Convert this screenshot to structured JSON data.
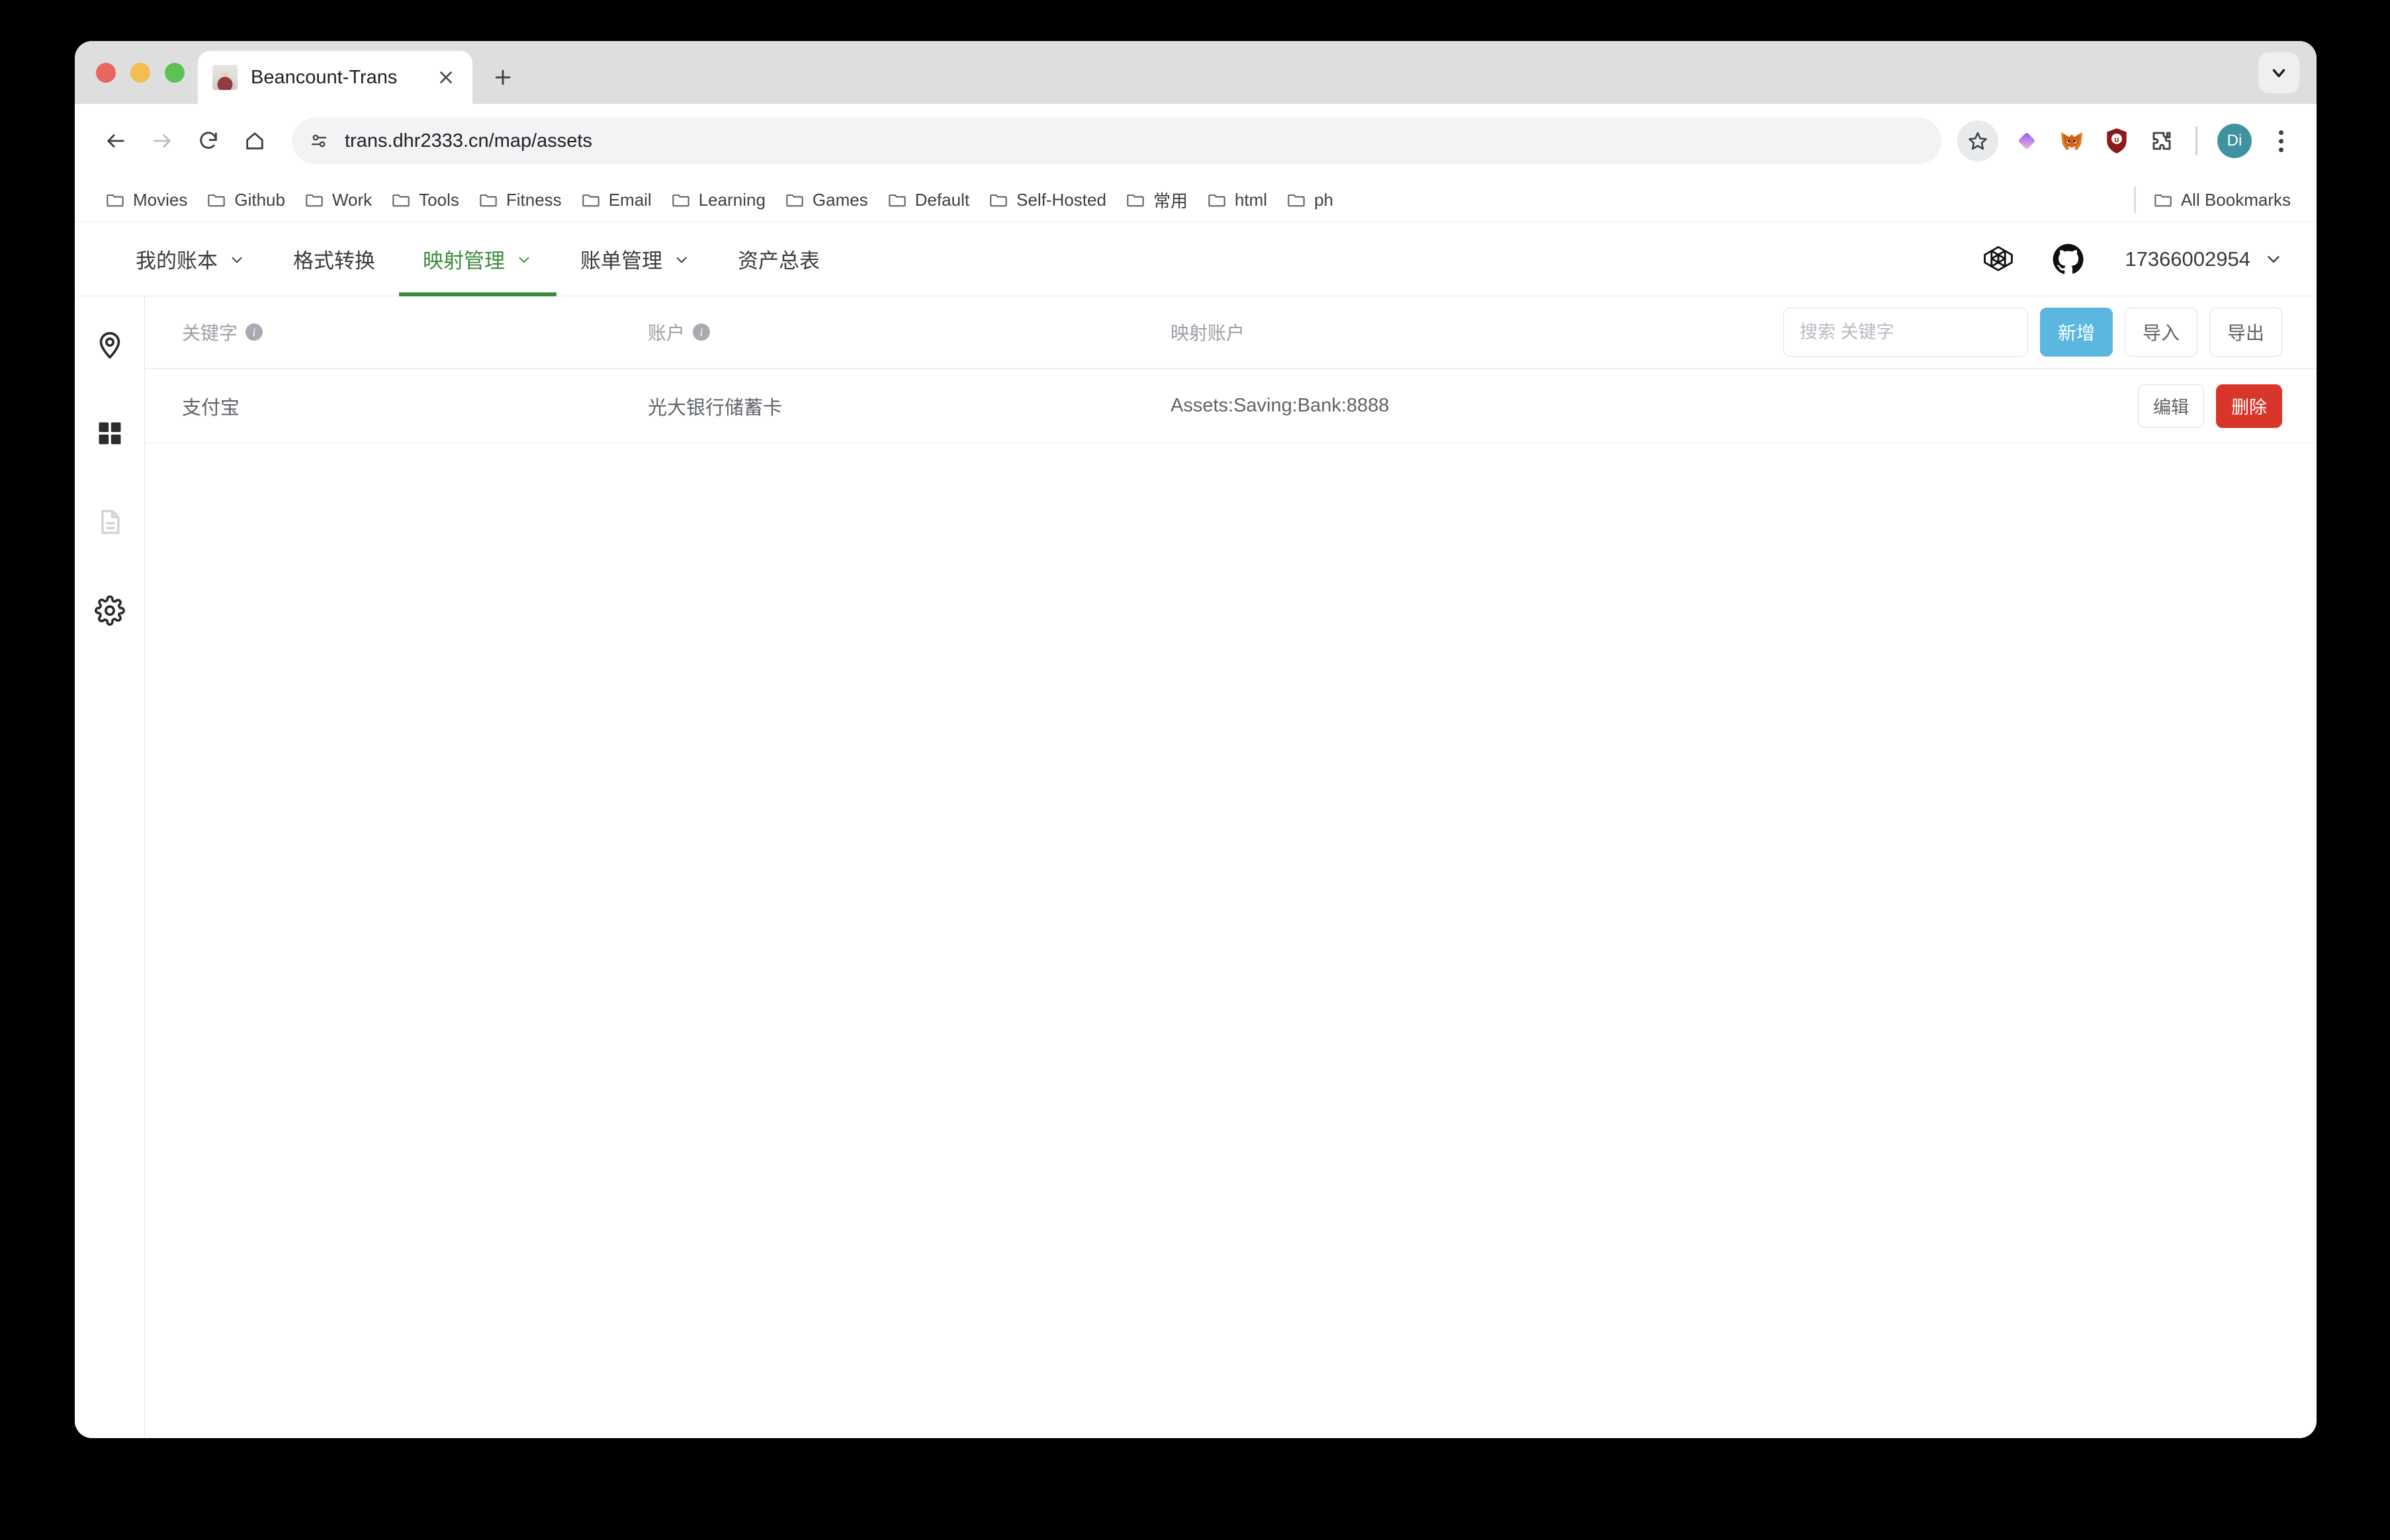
{
  "browser": {
    "tab": {
      "title": "Beancount-Trans",
      "close_label": "×",
      "new_tab_label": "+"
    },
    "toolbar": {
      "back_icon": "back-arrow-icon",
      "forward_icon": "forward-arrow-icon",
      "reload_icon": "reload-icon",
      "home_icon": "home-icon",
      "site_info_icon": "site-settings-icon",
      "url": "trans.dhr2333.cn/map/assets",
      "bookmark_icon": "star-icon",
      "profile_initials": "Di",
      "extensions": [
        "diamond-extension-icon",
        "metamask-icon",
        "ublock-origin-icon",
        "puzzle-extensions-icon"
      ]
    },
    "bookmarks": {
      "items": [
        {
          "label": "Movies"
        },
        {
          "label": "Github"
        },
        {
          "label": "Work"
        },
        {
          "label": "Tools"
        },
        {
          "label": "Fitness"
        },
        {
          "label": "Email"
        },
        {
          "label": "Learning"
        },
        {
          "label": "Games"
        },
        {
          "label": "Default"
        },
        {
          "label": "Self-Hosted"
        },
        {
          "label": "常用"
        },
        {
          "label": "html"
        },
        {
          "label": "ph"
        }
      ],
      "all_bookmarks_label": "All Bookmarks"
    }
  },
  "app": {
    "nav": {
      "items": [
        {
          "label": "我的账本",
          "has_dropdown": true,
          "active": false
        },
        {
          "label": "格式转换",
          "has_dropdown": false,
          "active": false
        },
        {
          "label": "映射管理",
          "has_dropdown": true,
          "active": true
        },
        {
          "label": "账单管理",
          "has_dropdown": true,
          "active": false
        },
        {
          "label": "资产总表",
          "has_dropdown": false,
          "active": false
        }
      ],
      "openai_icon": "openai-logo-icon",
      "github_icon": "github-logo-icon",
      "account_name": "17366002954"
    },
    "sidebar": {
      "items": [
        {
          "icon": "location-pin-icon",
          "muted": false
        },
        {
          "icon": "grid-apps-icon",
          "muted": false
        },
        {
          "icon": "document-icon",
          "muted": true
        },
        {
          "icon": "gear-settings-icon",
          "muted": false
        }
      ]
    },
    "table": {
      "columns": [
        {
          "label": "关键字",
          "info": true
        },
        {
          "label": "账户",
          "info": true
        },
        {
          "label": "映射账户",
          "info": false
        }
      ],
      "toolbar": {
        "search_placeholder": "搜索 关键字",
        "search_value": "",
        "add_label": "新增",
        "import_label": "导入",
        "export_label": "导出"
      },
      "rows": [
        {
          "keyword": "支付宝",
          "account": "光大银行储蓄卡",
          "mapped_account": "Assets:Saving:Bank:8888",
          "edit_label": "编辑",
          "delete_label": "删除"
        }
      ]
    }
  },
  "colors": {
    "accent_green": "#3c8a3c",
    "primary_blue": "#5bb7e0",
    "danger_red": "#d9362b",
    "avatar_teal": "#3f93a0"
  }
}
